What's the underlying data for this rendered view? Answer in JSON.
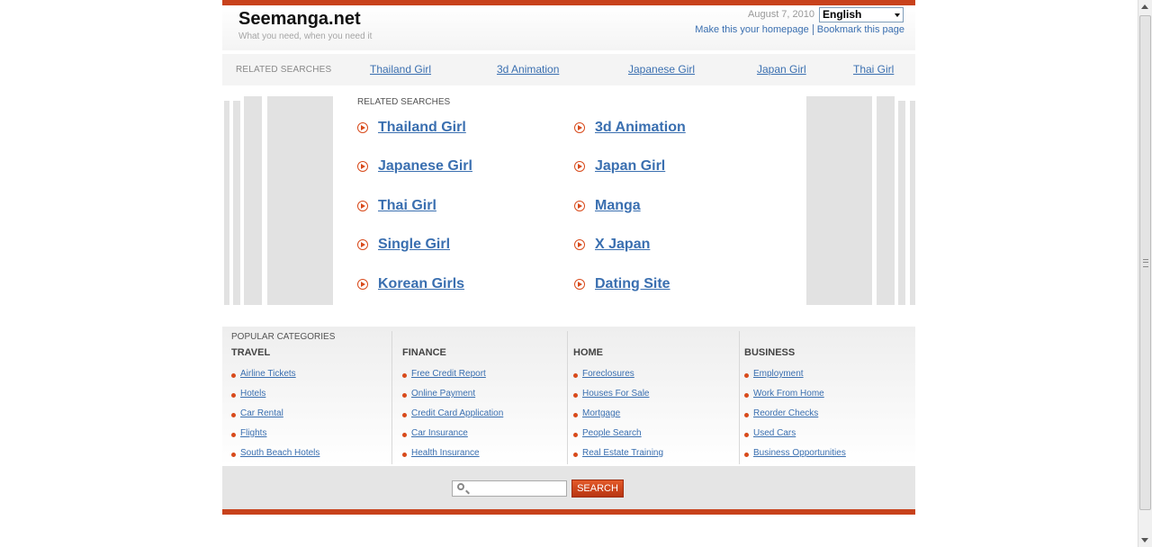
{
  "header": {
    "site_title": "Seemanga.net",
    "tagline": "What you need, when you need it",
    "date": "August 7, 2010",
    "language": "English",
    "make_homepage": "Make this your homepage",
    "bookmark": "Bookmark this page"
  },
  "top_related": {
    "label": "RELATED SEARCHES",
    "links": [
      "Thailand Girl",
      "3d Animation",
      "Japanese Girl",
      "Japan Girl",
      "Thai Girl"
    ]
  },
  "main_related": {
    "label": "RELATED SEARCHES",
    "left": [
      "Thailand Girl",
      "Japanese Girl",
      "Thai Girl",
      "Single Girl",
      "Korean Girls"
    ],
    "right": [
      "3d Animation",
      "Japan Girl",
      "Manga",
      "X Japan",
      "Dating Site"
    ]
  },
  "popular": {
    "label": "POPULAR CATEGORIES",
    "columns": [
      {
        "title": "TRAVEL",
        "items": [
          "Airline Tickets",
          "Hotels",
          "Car Rental",
          "Flights",
          "South Beach Hotels"
        ]
      },
      {
        "title": "FINANCE",
        "items": [
          "Free Credit Report",
          "Online Payment",
          "Credit Card Application",
          "Car Insurance",
          "Health Insurance"
        ]
      },
      {
        "title": "HOME",
        "items": [
          "Foreclosures",
          "Houses For Sale",
          "Mortgage",
          "People Search",
          "Real Estate Training"
        ]
      },
      {
        "title": "BUSINESS",
        "items": [
          "Employment",
          "Work From Home",
          "Reorder Checks",
          "Used Cars",
          "Business Opportunities"
        ]
      }
    ]
  },
  "search": {
    "value": "",
    "button": "SEARCH"
  },
  "colors": {
    "accent": "#c8421c",
    "link": "#3a6fb0"
  }
}
